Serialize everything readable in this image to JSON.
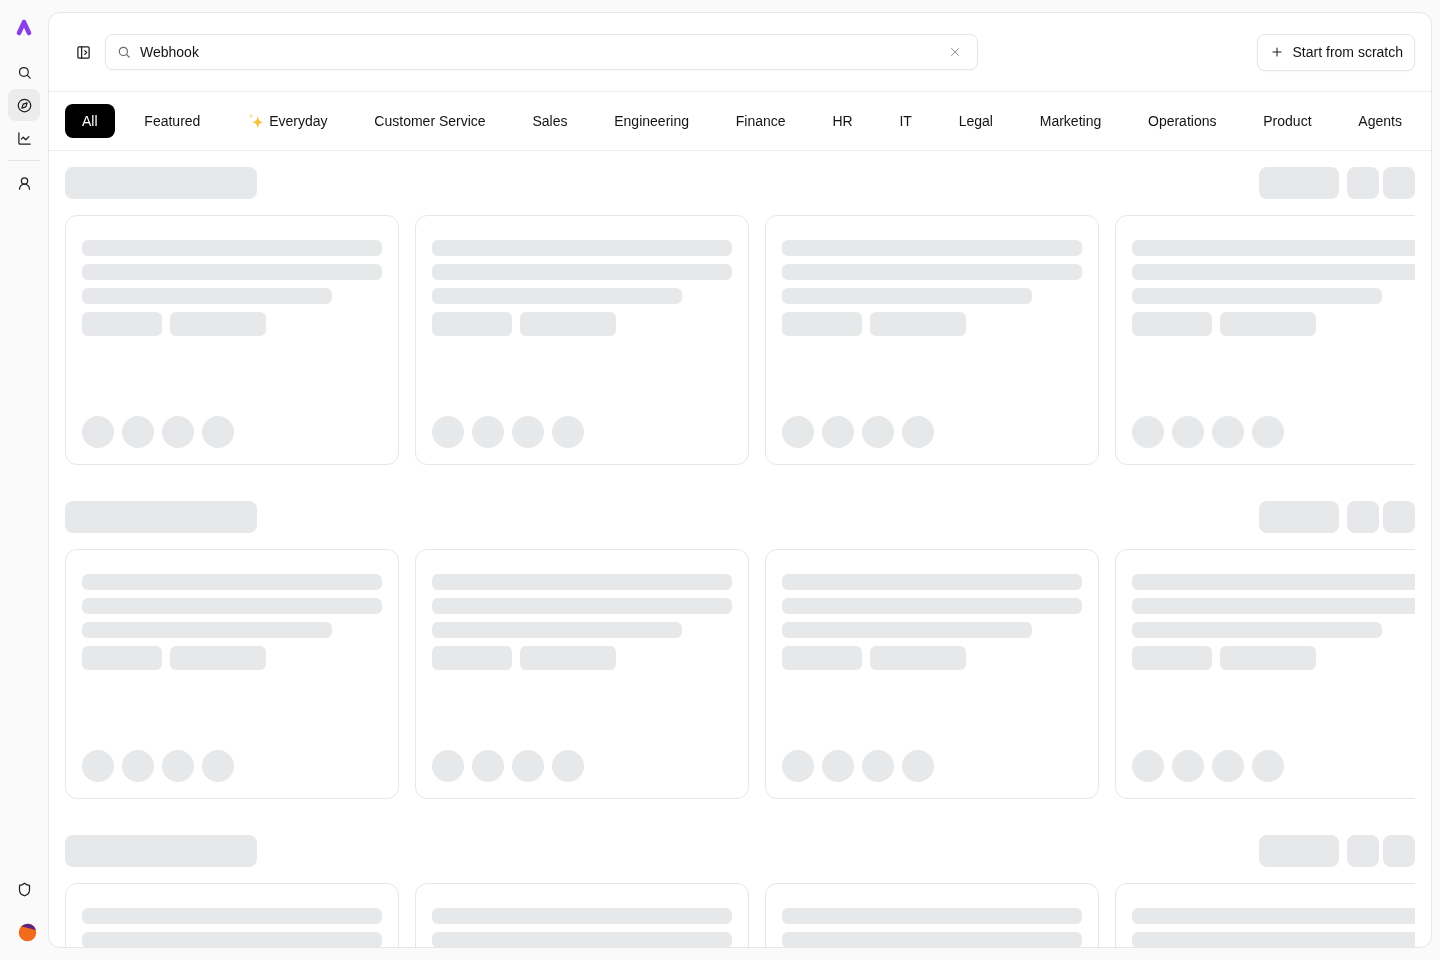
{
  "sidebar": {
    "items": [
      {
        "selected": false
      },
      {
        "selected": true
      },
      {
        "selected": false
      },
      {
        "selected": false
      }
    ]
  },
  "header": {
    "search": {
      "value": "Webhook"
    },
    "button": "Start from scratch"
  },
  "tabs": [
    {
      "label": "All",
      "selected": true,
      "kind": "plain"
    },
    {
      "label": "Featured",
      "selected": false,
      "kind": "plain"
    },
    {
      "label": "Everyday",
      "selected": false,
      "kind": "icon"
    },
    {
      "label": "Customer Service",
      "selected": false,
      "kind": "plain"
    },
    {
      "label": "Sales",
      "selected": false,
      "kind": "plain"
    },
    {
      "label": "Engineering",
      "selected": false,
      "kind": "plain"
    },
    {
      "label": "Finance",
      "selected": false,
      "kind": "plain"
    },
    {
      "label": "HR",
      "selected": false,
      "kind": "plain"
    },
    {
      "label": "IT",
      "selected": false,
      "kind": "plain"
    },
    {
      "label": "Legal",
      "selected": false,
      "kind": "plain"
    },
    {
      "label": "Marketing",
      "selected": false,
      "kind": "plain"
    },
    {
      "label": "Operations",
      "selected": false,
      "kind": "plain"
    },
    {
      "label": "Product",
      "selected": false,
      "kind": "plain"
    },
    {
      "label": "Agents",
      "selected": false,
      "kind": "plain"
    }
  ],
  "gallery": {
    "loading": true
  }
}
